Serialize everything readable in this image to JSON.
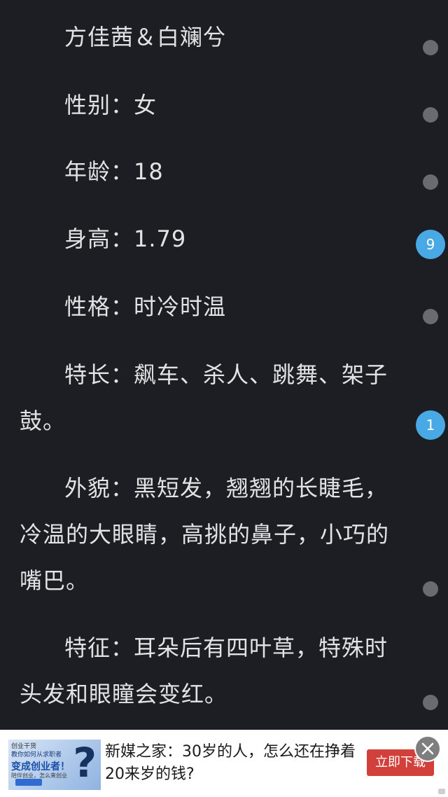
{
  "content": {
    "paragraphs": [
      "方佳茜＆白斓兮",
      "性别：女",
      "年龄：18",
      "身高：1.79",
      "性格：时冷时温",
      "特长：飙车、杀人、跳舞、架子鼓。",
      "外貌：黑短发，翘翘的长睫毛，冷温的大眼睛，高挑的鼻子，小巧的嘴巴。",
      "特征：耳朵后有四叶草，特殊时头发和眼瞳会变红。"
    ],
    "comment_counts": [
      "9",
      "1"
    ]
  },
  "ad": {
    "thumb": {
      "line1": "创业干货",
      "line2": "教你如何从求职者",
      "line3": "变成创业者！",
      "line4": "陪伴创业，怎么来创业",
      "glyph": "?"
    },
    "text": "新媒之家：30岁的人，怎么还在挣着20来岁的钱?",
    "cta": "立即下载"
  }
}
